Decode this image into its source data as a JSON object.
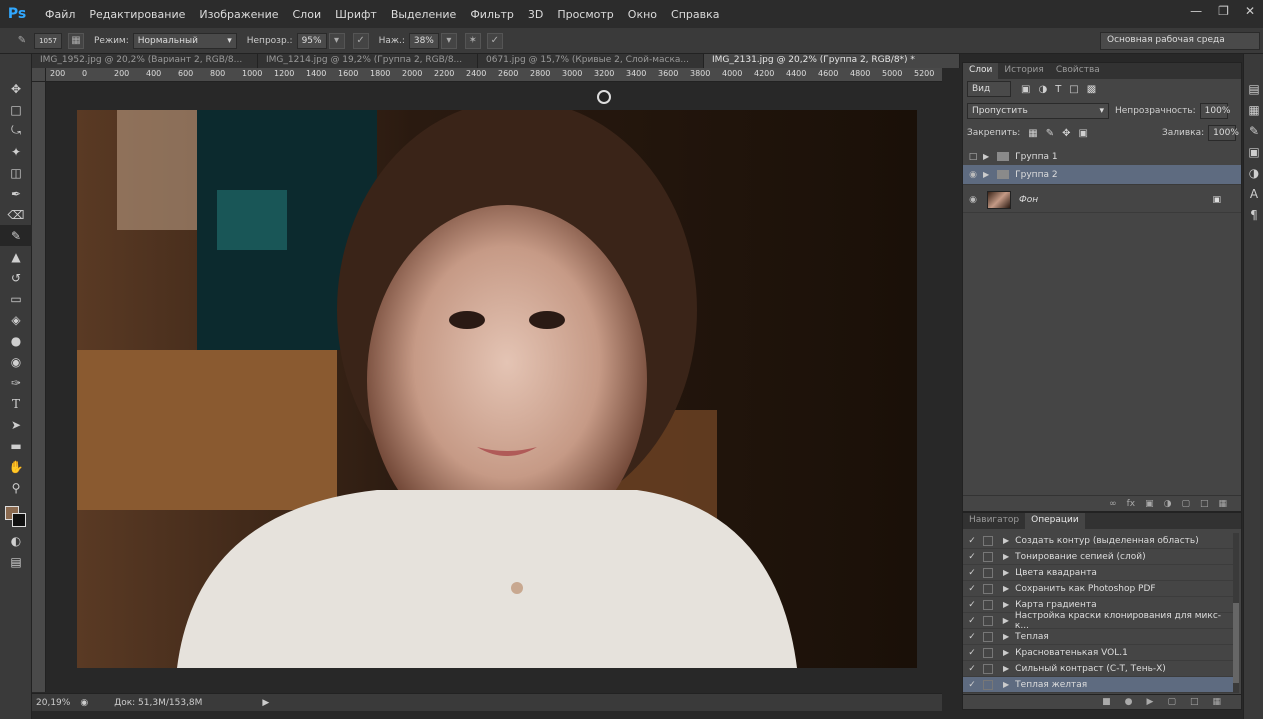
{
  "app": {
    "logo": "Ps"
  },
  "menu": [
    "Файл",
    "Редактирование",
    "Изображение",
    "Слои",
    "Шрифт",
    "Выделение",
    "Фильтр",
    "3D",
    "Просмотр",
    "Окно",
    "Справка"
  ],
  "options": {
    "brush_size": "1057",
    "mode_label": "Режим:",
    "mode_value": "Нормальный",
    "opacity_label": "Непрозр.:",
    "opacity_value": "95%",
    "flow_label": "Наж.:",
    "flow_value": "38%",
    "workspace": "Основная рабочая среда"
  },
  "tabs": [
    "IMG_1952.jpg @ 20,2% (Вариант 2, RGB/8...",
    "IMG_1214.jpg @ 19,2% (Группа 2, RGB/8...",
    "0671.jpg @ 15,7% (Кривые 2, Слой-маска...",
    "IMG_2131.jpg @ 20,2% (Группа 2, RGB/8*) *"
  ],
  "ruler_h": [
    "200",
    "0",
    "200",
    "400",
    "600",
    "800",
    "1000",
    "1200",
    "1400",
    "1600",
    "1800",
    "2000",
    "2200",
    "2400",
    "2600",
    "2800",
    "3000",
    "3200",
    "3400",
    "3600",
    "3800",
    "4000",
    "4200",
    "4400",
    "4600",
    "4800",
    "5000",
    "5200"
  ],
  "status": {
    "zoom": "20,19%",
    "doc": "Док: 51,3M/153,8M"
  },
  "layers_panel": {
    "tabs": [
      "Слои",
      "История",
      "Свойства"
    ],
    "kind": "Вид",
    "blend": "Пропустить",
    "opacity_label": "Непрозрачность:",
    "opacity": "100%",
    "lock_label": "Закрепить:",
    "fill_label": "Заливка:",
    "fill": "100%",
    "layers": [
      {
        "name": "Группа 1",
        "type": "group",
        "visible": false,
        "selected": false
      },
      {
        "name": "Группа 2",
        "type": "group",
        "visible": true,
        "selected": true
      },
      {
        "name": "Фон",
        "type": "image",
        "visible": true,
        "selected": false,
        "locked": true
      }
    ]
  },
  "actions_panel": {
    "tabs": [
      "Навигатор",
      "Операции"
    ],
    "items": [
      {
        "label": "Создать контур (выделенная область)",
        "dialog": true
      },
      {
        "label": "Тонирование сепией (слой)",
        "dialog": false
      },
      {
        "label": "Цвета квадранта",
        "dialog": false
      },
      {
        "label": "Сохранить как Photoshop PDF",
        "dialog": true
      },
      {
        "label": "Карта градиента",
        "dialog": false
      },
      {
        "label": "Настройка краски клонирования для микс-к...",
        "dialog": true
      },
      {
        "label": "Теплая",
        "dialog": false
      },
      {
        "label": "Красноватенькая VOL.1",
        "dialog": false
      },
      {
        "label": "Сильный контраст (С-Т, Тень-Х)",
        "dialog": false
      },
      {
        "label": "Теплая желтая",
        "dialog": false,
        "selected": true
      }
    ]
  },
  "colors": {
    "accent": "#5e6b80",
    "panel": "#454545",
    "dark": "#282828"
  }
}
